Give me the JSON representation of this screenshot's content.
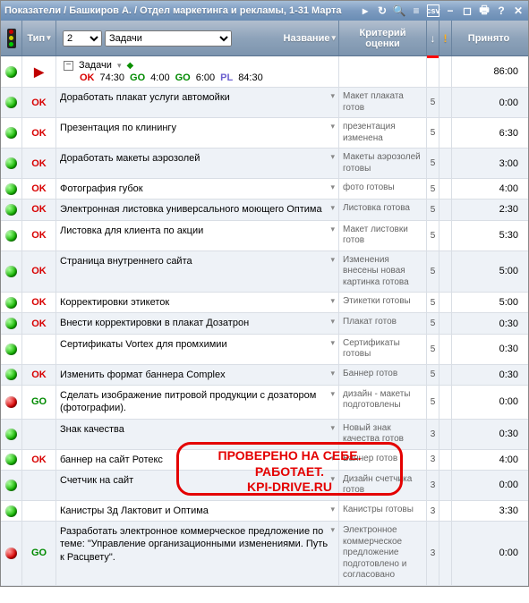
{
  "header": {
    "title": "Показатели / Башкиров А. / Отдел маркетинга и рекламы, 1-31 Марта"
  },
  "columns": {
    "type": "Тип",
    "name": "Название",
    "criteria": "Критерий оценки",
    "accepted": "Принято"
  },
  "controls": {
    "level": "2",
    "filter": "Задачи"
  },
  "summary": {
    "label": "Задачи",
    "segments": [
      {
        "tag": "OK",
        "val": "74:30"
      },
      {
        "tag": "GO",
        "val": "4:00"
      },
      {
        "tag": "GO",
        "val": "6:00"
      },
      {
        "tag": "PL",
        "val": "84:30"
      }
    ],
    "accepted": "86:00"
  },
  "rows": [
    {
      "light": "green",
      "type": "OK",
      "name": "Доработать плакат услуги автомойки",
      "criteria": "Макет плаката готов",
      "priority": "5",
      "accepted": "0:00"
    },
    {
      "light": "green",
      "type": "OK",
      "name": "Презентация по клинингу",
      "criteria": "презентация изменена",
      "priority": "5",
      "accepted": "6:30"
    },
    {
      "light": "green",
      "type": "OK",
      "name": "Доработать макеты аэрозолей",
      "criteria": "Макеты аэрозолей готовы",
      "priority": "5",
      "accepted": "3:00"
    },
    {
      "light": "green",
      "type": "OK",
      "name": "Фотография губок",
      "criteria": "фото готовы",
      "priority": "5",
      "accepted": "4:00"
    },
    {
      "light": "green",
      "type": "OK",
      "name": "Электронная листовка универсального моющего Оптима",
      "criteria": "Листовка готова",
      "priority": "5",
      "accepted": "2:30"
    },
    {
      "light": "green",
      "type": "OK",
      "name": "Листовка для клиента по акции",
      "criteria": "Макет листовки готов",
      "priority": "5",
      "accepted": "5:30"
    },
    {
      "light": "green",
      "type": "OK",
      "name": "Страница внутреннего сайта",
      "criteria": "Изменения внесены новая картинка готова",
      "priority": "5",
      "accepted": "5:00"
    },
    {
      "light": "green",
      "type": "OK",
      "name": "Корректировки этикеток",
      "criteria": "Этикетки готовы",
      "priority": "5",
      "accepted": "5:00"
    },
    {
      "light": "green",
      "type": "OK",
      "name": "Внести корректировки в плакат Дозатрон",
      "criteria": "Плакат готов",
      "priority": "5",
      "accepted": "0:30"
    },
    {
      "light": "green",
      "type": "",
      "name": "Сертификаты Vortex для промхимии",
      "criteria": "Сертификаты готовы",
      "priority": "5",
      "accepted": "0:30"
    },
    {
      "light": "green",
      "type": "OK",
      "name": "Изменить формат баннера Complex",
      "criteria": "Баннер готов",
      "priority": "5",
      "accepted": "0:30"
    },
    {
      "light": "red",
      "type": "GO",
      "name": "Сделать изображение питровой продукции с дозатором (фотографии).",
      "criteria": "дизайн - макеты подготовлены",
      "priority": "5",
      "accepted": "0:00"
    },
    {
      "light": "green",
      "type": "",
      "name": "Знак качества",
      "criteria": "Новый знак качества готов",
      "priority": "3",
      "accepted": "0:30"
    },
    {
      "light": "green",
      "type": "OK",
      "name": "баннер на сайт Ротекс",
      "criteria": "Баннер готов",
      "priority": "3",
      "accepted": "4:00"
    },
    {
      "light": "green",
      "type": "",
      "name": "Счетчик на сайт",
      "criteria": "Дизайн счетчика готов",
      "priority": "3",
      "accepted": "0:00"
    },
    {
      "light": "green",
      "type": "",
      "name": "Канистры 3д Лактовит и Оптима",
      "criteria": "Канистры готовы",
      "priority": "3",
      "accepted": "3:30"
    },
    {
      "light": "red",
      "type": "GO",
      "name": "Разработать электронное коммерческое предложение по теме: \"Управление организационными изменениями. Путь к Расцвету\".",
      "criteria": "Электронное коммерческое предложение подготовлено и согласовано",
      "priority": "3",
      "accepted": "0:00"
    }
  ],
  "stamp": {
    "line1": "ПРОВЕРЕНО НА СЕБЕ.",
    "line2": "РАБОТАЕТ.",
    "site": "KPI-DRIVE.RU"
  }
}
